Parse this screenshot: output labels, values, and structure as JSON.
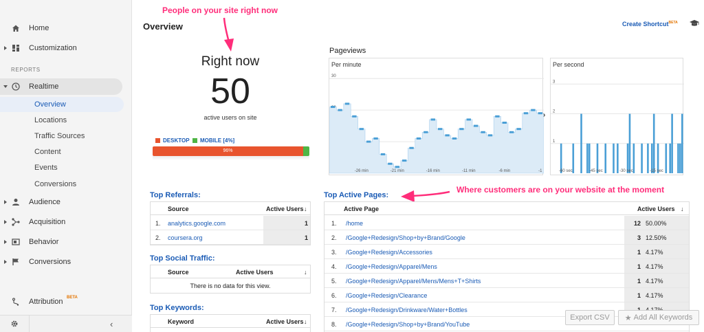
{
  "sidebar": {
    "home": "Home",
    "customization": "Customization",
    "reports_label": "REPORTS",
    "realtime": "Realtime",
    "realtime_sub": [
      "Overview",
      "Locations",
      "Traffic Sources",
      "Content",
      "Events",
      "Conversions"
    ],
    "audience": "Audience",
    "acquisition": "Acquisition",
    "behavior": "Behavior",
    "conversions": "Conversions",
    "attribution": "Attribution",
    "attribution_badge": "BETA"
  },
  "header": {
    "title": "Overview",
    "create_shortcut": "Create Shortcut",
    "create_shortcut_badge": "BETA"
  },
  "annotations": {
    "top": "People on your site right now",
    "right": "Where customers are on your website at the moment"
  },
  "right_now": {
    "title": "Right now",
    "count": "50",
    "subtitle": "active users on site",
    "desktop_label": "DESKTOP",
    "mobile_label": "MOBILE [4%]",
    "desktop_pct_label": "96%",
    "desktop_fraction": 0.96,
    "desktop_color": "#e8542e",
    "mobile_color": "#4fb545"
  },
  "pageviews": {
    "title": "Pageviews",
    "per_minute_label": "Per minute",
    "per_second_label": "Per second",
    "minute_yticks": [
      "30",
      "20",
      "10"
    ],
    "minute_xticks": [
      "-26 min",
      "-21 min",
      "-16 min",
      "-11 min",
      "-6 min",
      "-1"
    ],
    "second_yticks": [
      "3",
      "2",
      "1"
    ],
    "second_xticks": [
      "-60 sec",
      "-45 sec",
      "-30 sec",
      "-15 sec"
    ]
  },
  "chart_data": [
    {
      "type": "area",
      "title": "Per minute",
      "x": [
        -30,
        -29,
        -28,
        -27,
        -26,
        -25,
        -24,
        -23,
        -22,
        -21,
        -20,
        -19,
        -18,
        -17,
        -16,
        -15,
        -14,
        -13,
        -12,
        -11,
        -10,
        -9,
        -8,
        -7,
        -6,
        -5,
        -4,
        -3,
        -2,
        -1
      ],
      "values": [
        21,
        20,
        22,
        18,
        14,
        10,
        11,
        6,
        3,
        2,
        4,
        8,
        11,
        13,
        17,
        14,
        12,
        11,
        14,
        17,
        15,
        13,
        12,
        18,
        16,
        13,
        14,
        19,
        20,
        19
      ],
      "ylim": [
        0,
        32
      ],
      "color": "#4a9fd6"
    },
    {
      "type": "bar",
      "title": "Per second",
      "x": [
        -60,
        -54,
        -50,
        -47,
        -46,
        -42,
        -38,
        -34,
        -32,
        -27,
        -26,
        -24,
        -20,
        -17,
        -15,
        -14,
        -12,
        -8,
        -6,
        -5,
        -2,
        -1,
        0
      ],
      "values": [
        1,
        1,
        2,
        1,
        1,
        1,
        1,
        1,
        1,
        1,
        2,
        1,
        1,
        1,
        1,
        2,
        1,
        1,
        1,
        2,
        1,
        1,
        2
      ],
      "ylim": [
        0,
        3.4
      ],
      "color": "#4a9fd6"
    }
  ],
  "top_referrals": {
    "title": "Top Referrals:",
    "col_source": "Source",
    "col_active": "Active Users",
    "rows": [
      {
        "n": "1.",
        "source": "analytics.google.com",
        "users": "1"
      },
      {
        "n": "2.",
        "source": "coursera.org",
        "users": "1"
      }
    ]
  },
  "top_social": {
    "title": "Top Social Traffic:",
    "col_source": "Source",
    "col_active": "Active Users",
    "empty": "There is no data for this view."
  },
  "top_keywords": {
    "title": "Top Keywords:",
    "col_keyword": "Keyword",
    "col_active": "Active Users"
  },
  "top_pages": {
    "title": "Top Active Pages:",
    "col_page": "Active Page",
    "col_active": "Active Users",
    "rows": [
      {
        "n": "1.",
        "page": "/home",
        "users": "12",
        "pct": "50.00%"
      },
      {
        "n": "2.",
        "page": "/Google+Redesign/Shop+by+Brand/Google",
        "users": "3",
        "pct": "12.50%"
      },
      {
        "n": "3.",
        "page": "/Google+Redesign/Accessories",
        "users": "1",
        "pct": "4.17%"
      },
      {
        "n": "4.",
        "page": "/Google+Redesign/Apparel/Mens",
        "users": "1",
        "pct": "4.17%"
      },
      {
        "n": "5.",
        "page": "/Google+Redesign/Apparel/Mens/Mens+T+Shirts",
        "users": "1",
        "pct": "4.17%"
      },
      {
        "n": "6.",
        "page": "/Google+Redesign/Clearance",
        "users": "1",
        "pct": "4.17%"
      },
      {
        "n": "7.",
        "page": "/Google+Redesign/Drinkware/Water+Bottles",
        "users": "1",
        "pct": "4.17%"
      },
      {
        "n": "8.",
        "page": "/Google+Redesign/Shop+by+Brand/YouTube",
        "users": "",
        "pct": ""
      }
    ]
  },
  "buttons": {
    "export_csv": "Export CSV",
    "add_keywords": "Add All Keywords"
  }
}
